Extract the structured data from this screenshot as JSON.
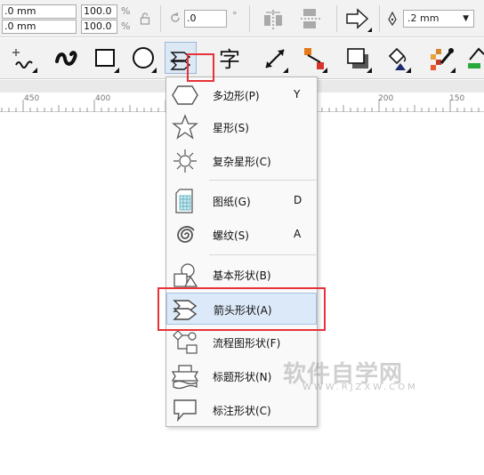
{
  "property_bar": {
    "x_value": ".0 mm",
    "y_value": ".0 mm",
    "scale_x": "100.0",
    "scale_y": "100.0",
    "percent_unit": "%",
    "rotation_value": ".0",
    "degree_unit": "°",
    "outline_width": ".2 mm"
  },
  "ruler": {
    "labels": [
      "450",
      "400",
      "200",
      "150"
    ]
  },
  "menu": {
    "items": [
      {
        "label": "多边形(P)",
        "key": "Y"
      },
      {
        "label": "星形(S)",
        "key": ""
      },
      {
        "label": "复杂星形(C)",
        "key": ""
      },
      {
        "label": "图纸(G)",
        "key": "D"
      },
      {
        "label": "螺纹(S)",
        "key": "A"
      },
      {
        "label": "基本形状(B)",
        "key": ""
      },
      {
        "label": "箭头形状(A)",
        "key": ""
      },
      {
        "label": "流程图形状(F)",
        "key": ""
      },
      {
        "label": "标题形状(N)",
        "key": ""
      },
      {
        "label": "标注形状(C)",
        "key": ""
      }
    ]
  },
  "watermark": {
    "main": "软件自学网",
    "sub": "WWW.RJZXW.COM"
  },
  "colors": {
    "highlight_red": "#e8323a",
    "selection_blue": "#dbe9f8"
  }
}
